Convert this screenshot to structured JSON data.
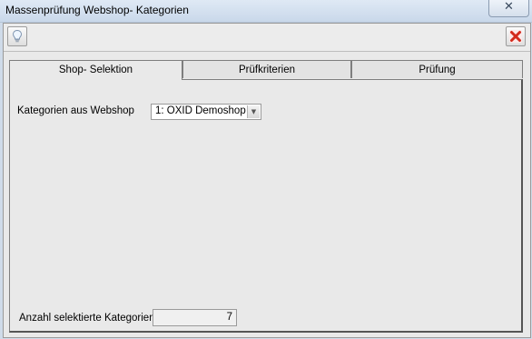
{
  "window": {
    "title": "Massenprüfung Webshop- Kategorien",
    "close_glyph": "✕"
  },
  "toolbar": {
    "info_icon": "lightbulb-icon",
    "close_icon": "red-x-icon"
  },
  "tabs": [
    {
      "label": "Shop- Selektion",
      "active": true
    },
    {
      "label": "Prüfkriterien",
      "active": false
    },
    {
      "label": "Prüfung",
      "active": false
    }
  ],
  "shop_selection": {
    "categories_label": "Kategorien aus Webshop",
    "shop_select_value": "1: OXID Demoshop",
    "selected_count_label": "Anzahl selektierte Kategorien",
    "selected_count_value": "7"
  }
}
